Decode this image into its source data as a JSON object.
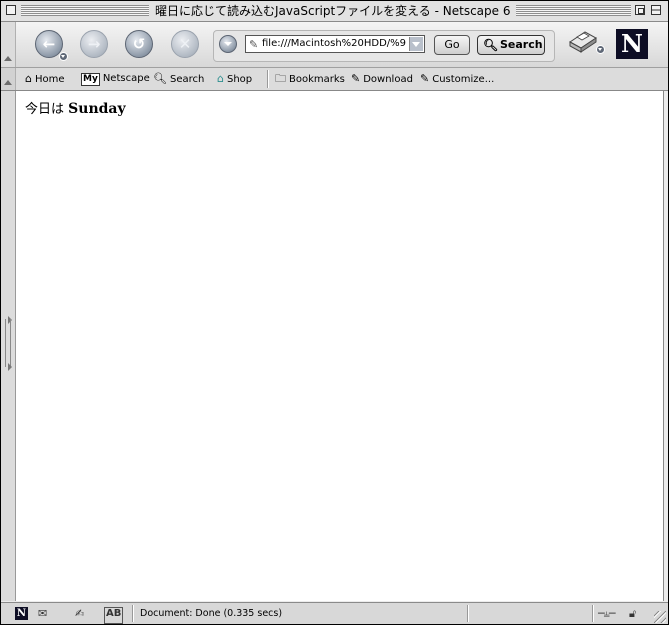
{
  "window": {
    "title": "曜日に応じて読み込むJavaScriptファイルを変える - Netscape 6"
  },
  "navigation": {
    "back_icon": "back-arrow-icon",
    "forward_icon": "forward-arrow-icon",
    "reload_icon": "reload-icon",
    "stop_icon": "stop-icon",
    "url_value": "file:///Macintosh%20HDD/%9",
    "go_label": "Go",
    "search_label": "Search"
  },
  "personal_toolbar": {
    "items": [
      {
        "label": "Home",
        "icon": "home-icon"
      },
      {
        "label": "Netscape",
        "icon": "my-netscape-icon",
        "badge": "My"
      },
      {
        "label": "Search",
        "icon": "search-icon"
      },
      {
        "label": "Shop",
        "icon": "shop-icon"
      },
      {
        "label": "Bookmarks",
        "icon": "bookmarks-folder-icon"
      },
      {
        "label": "Download",
        "icon": "bookmark-link-icon"
      },
      {
        "label": "Customize...",
        "icon": "bookmark-link-icon"
      }
    ]
  },
  "page": {
    "prefix": "今日は",
    "day": "Sunday"
  },
  "status": {
    "text": "Document: Done (0.335 secs)"
  }
}
